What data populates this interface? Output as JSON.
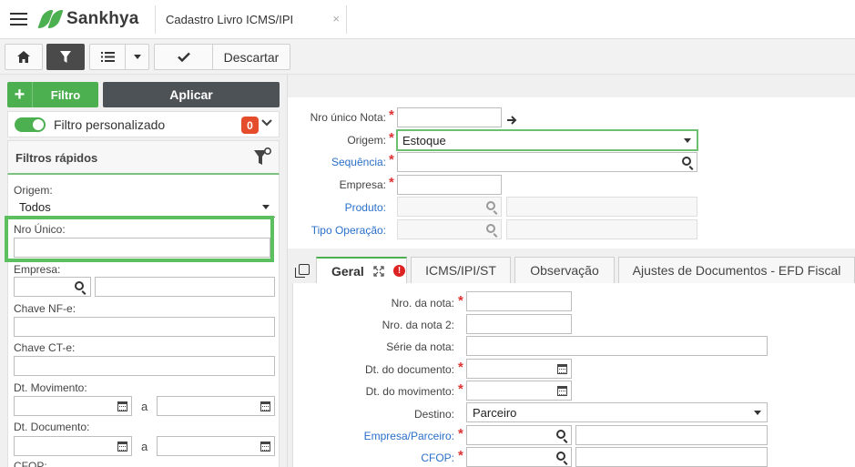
{
  "app": {
    "brand": "Sankhya",
    "accent": "#4caf50"
  },
  "doc_tab": {
    "label": "Cadastro Livro ICMS/IPI",
    "close": "×"
  },
  "toolbar": {
    "home_icon": "home-icon",
    "filter_icon": "filter-icon",
    "list_icon": "list-icon",
    "confirm_icon": "check-icon",
    "discard_label": "Descartar"
  },
  "filters": {
    "add_label": "Filtro",
    "add_symbol": "+",
    "apply_label": "Aplicar",
    "custom_label": "Filtro personalizado",
    "custom_count": "0",
    "quick_title": "Filtros rápidos",
    "origem_label": "Origem:",
    "origem_value": "Todos",
    "nro_unico_label": "Nro Único:",
    "empresa_label": "Empresa:",
    "chave_nfe_label": "Chave NF-e:",
    "chave_cte_label": "Chave CT-e:",
    "dt_mov_label": "Dt. Movimento:",
    "dt_doc_label": "Dt. Documento:",
    "range_sep": "a",
    "cfop_label": "CFOP:"
  },
  "form": {
    "nro_unico_nota_label": "Nro único Nota:",
    "origem_label": "Origem:",
    "origem_value": "Estoque",
    "sequencia_label": "Sequência:",
    "empresa_label": "Empresa:",
    "produto_label": "Produto:",
    "tipo_operacao_label": "Tipo Operação:"
  },
  "tabs": [
    {
      "label": "Geral"
    },
    {
      "label": "ICMS/IPI/ST"
    },
    {
      "label": "Observação"
    },
    {
      "label": "Ajustes de Documentos - EFD Fiscal"
    }
  ],
  "geral": {
    "nro_nota_label": "Nro. da nota:",
    "nro_nota2_label": "Nro. da nota 2:",
    "serie_label": "Série da nota:",
    "dt_documento_label": "Dt. do documento:",
    "dt_movimento_label": "Dt. do movimento:",
    "destino_label": "Destino:",
    "destino_value": "Parceiro",
    "empresa_parceiro_label": "Empresa/Parceiro:",
    "cfop_label": "CFOP:"
  },
  "required_mark": "*",
  "badge_error": "!"
}
